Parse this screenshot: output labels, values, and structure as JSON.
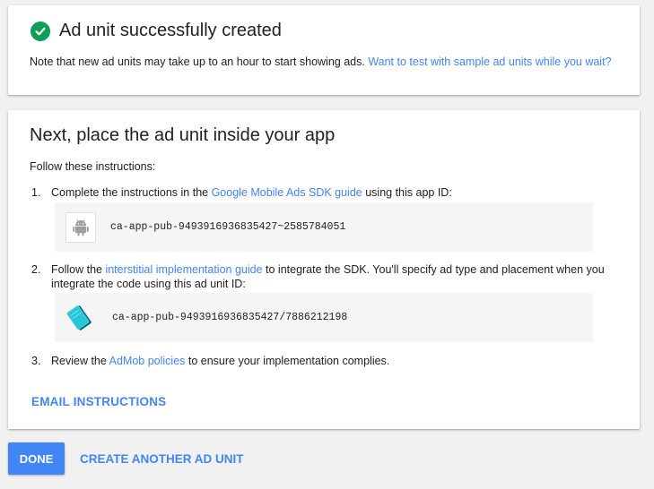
{
  "success_card": {
    "title": "Ad unit successfully created",
    "note": "Note that new ad units may take up to an hour to start showing ads.",
    "note_link": "Want to test with sample ad units while you wait?"
  },
  "instructions_card": {
    "title": "Next, place the ad unit inside your app",
    "follow": "Follow these instructions:",
    "step1": {
      "num": "1.",
      "pre": "Complete the instructions in the ",
      "link": "Google Mobile Ads SDK guide",
      "post": " using this app ID:",
      "code": "ca-app-pub-9493916936835427~2585784051",
      "icon": "android-icon"
    },
    "step2": {
      "num": "2.",
      "pre": "Follow the ",
      "link": "interstitial implementation guide",
      "post": " to integrate the SDK. You'll specify ad type and placement when you integrate the code using this ad unit ID:",
      "code": "ca-app-pub-9493916936835427/7886212198",
      "icon": "interstitial-icon"
    },
    "step3": {
      "num": "3.",
      "pre": "Review the ",
      "link": "AdMob policies",
      "post": " to ensure your implementation complies."
    },
    "email_label": "EMAIL INSTRUCTIONS"
  },
  "footer": {
    "done_label": "DONE",
    "another_label": "CREATE ANOTHER AD UNIT"
  },
  "colors": {
    "accent": "#4285f4",
    "success": "#0f9d58"
  }
}
